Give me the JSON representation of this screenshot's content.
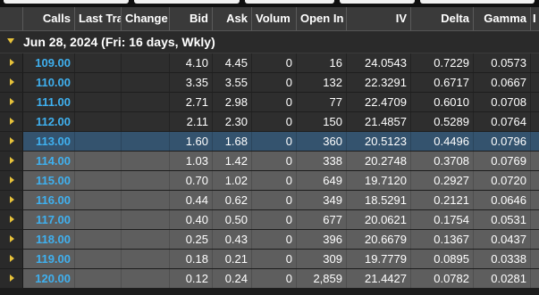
{
  "columns": {
    "calls": "Calls",
    "last_trade": "Last Tra",
    "change": "Change",
    "bid": "Bid",
    "ask": "Ask",
    "volume": "Volum",
    "open_interest": "Open In",
    "iv": "IV",
    "delta": "Delta",
    "gamma": "Gamma",
    "extra": "I"
  },
  "expiry_group": {
    "label": "Jun 28, 2024 (Fri: 16 days, Wkly)"
  },
  "colors": {
    "strike": "#3fb0ef",
    "in_the_money_row": "#2e2e2e",
    "out_of_money_row": "#5e5e5e",
    "selected_row": "#34536e",
    "expander_arrow": "#e6c13a"
  },
  "rows": [
    {
      "strike": "109.00",
      "last": "",
      "change": "",
      "bid": "4.10",
      "ask": "4.45",
      "volume": "0",
      "oi": "16",
      "iv": "24.0543",
      "delta": "0.7229",
      "gamma": "0.0573",
      "state": "itm"
    },
    {
      "strike": "110.00",
      "last": "",
      "change": "",
      "bid": "3.35",
      "ask": "3.55",
      "volume": "0",
      "oi": "132",
      "iv": "22.3291",
      "delta": "0.6717",
      "gamma": "0.0667",
      "state": "itm"
    },
    {
      "strike": "111.00",
      "last": "",
      "change": "",
      "bid": "2.71",
      "ask": "2.98",
      "volume": "0",
      "oi": "77",
      "iv": "22.4709",
      "delta": "0.6010",
      "gamma": "0.0708",
      "state": "itm"
    },
    {
      "strike": "112.00",
      "last": "",
      "change": "",
      "bid": "2.11",
      "ask": "2.30",
      "volume": "0",
      "oi": "150",
      "iv": "21.4857",
      "delta": "0.5289",
      "gamma": "0.0764",
      "state": "itm"
    },
    {
      "strike": "113.00",
      "last": "",
      "change": "",
      "bid": "1.60",
      "ask": "1.68",
      "volume": "0",
      "oi": "360",
      "iv": "20.5123",
      "delta": "0.4496",
      "gamma": "0.0796",
      "state": "sel"
    },
    {
      "strike": "114.00",
      "last": "",
      "change": "",
      "bid": "1.03",
      "ask": "1.42",
      "volume": "0",
      "oi": "338",
      "iv": "20.2748",
      "delta": "0.3708",
      "gamma": "0.0769",
      "state": "otm"
    },
    {
      "strike": "115.00",
      "last": "",
      "change": "",
      "bid": "0.70",
      "ask": "1.02",
      "volume": "0",
      "oi": "649",
      "iv": "19.7120",
      "delta": "0.2927",
      "gamma": "0.0720",
      "state": "otm"
    },
    {
      "strike": "116.00",
      "last": "",
      "change": "",
      "bid": "0.44",
      "ask": "0.62",
      "volume": "0",
      "oi": "349",
      "iv": "18.5291",
      "delta": "0.2121",
      "gamma": "0.0646",
      "state": "otm"
    },
    {
      "strike": "117.00",
      "last": "",
      "change": "",
      "bid": "0.40",
      "ask": "0.50",
      "volume": "0",
      "oi": "677",
      "iv": "20.0621",
      "delta": "0.1754",
      "gamma": "0.0531",
      "state": "otm"
    },
    {
      "strike": "118.00",
      "last": "",
      "change": "",
      "bid": "0.25",
      "ask": "0.43",
      "volume": "0",
      "oi": "396",
      "iv": "20.6679",
      "delta": "0.1367",
      "gamma": "0.0437",
      "state": "otm"
    },
    {
      "strike": "119.00",
      "last": "",
      "change": "",
      "bid": "0.18",
      "ask": "0.21",
      "volume": "0",
      "oi": "309",
      "iv": "19.7779",
      "delta": "0.0895",
      "gamma": "0.0338",
      "state": "otm"
    },
    {
      "strike": "120.00",
      "last": "",
      "change": "",
      "bid": "0.12",
      "ask": "0.24",
      "volume": "0",
      "oi": "2,859",
      "iv": "21.4427",
      "delta": "0.0782",
      "gamma": "0.0281",
      "state": "otm"
    }
  ]
}
